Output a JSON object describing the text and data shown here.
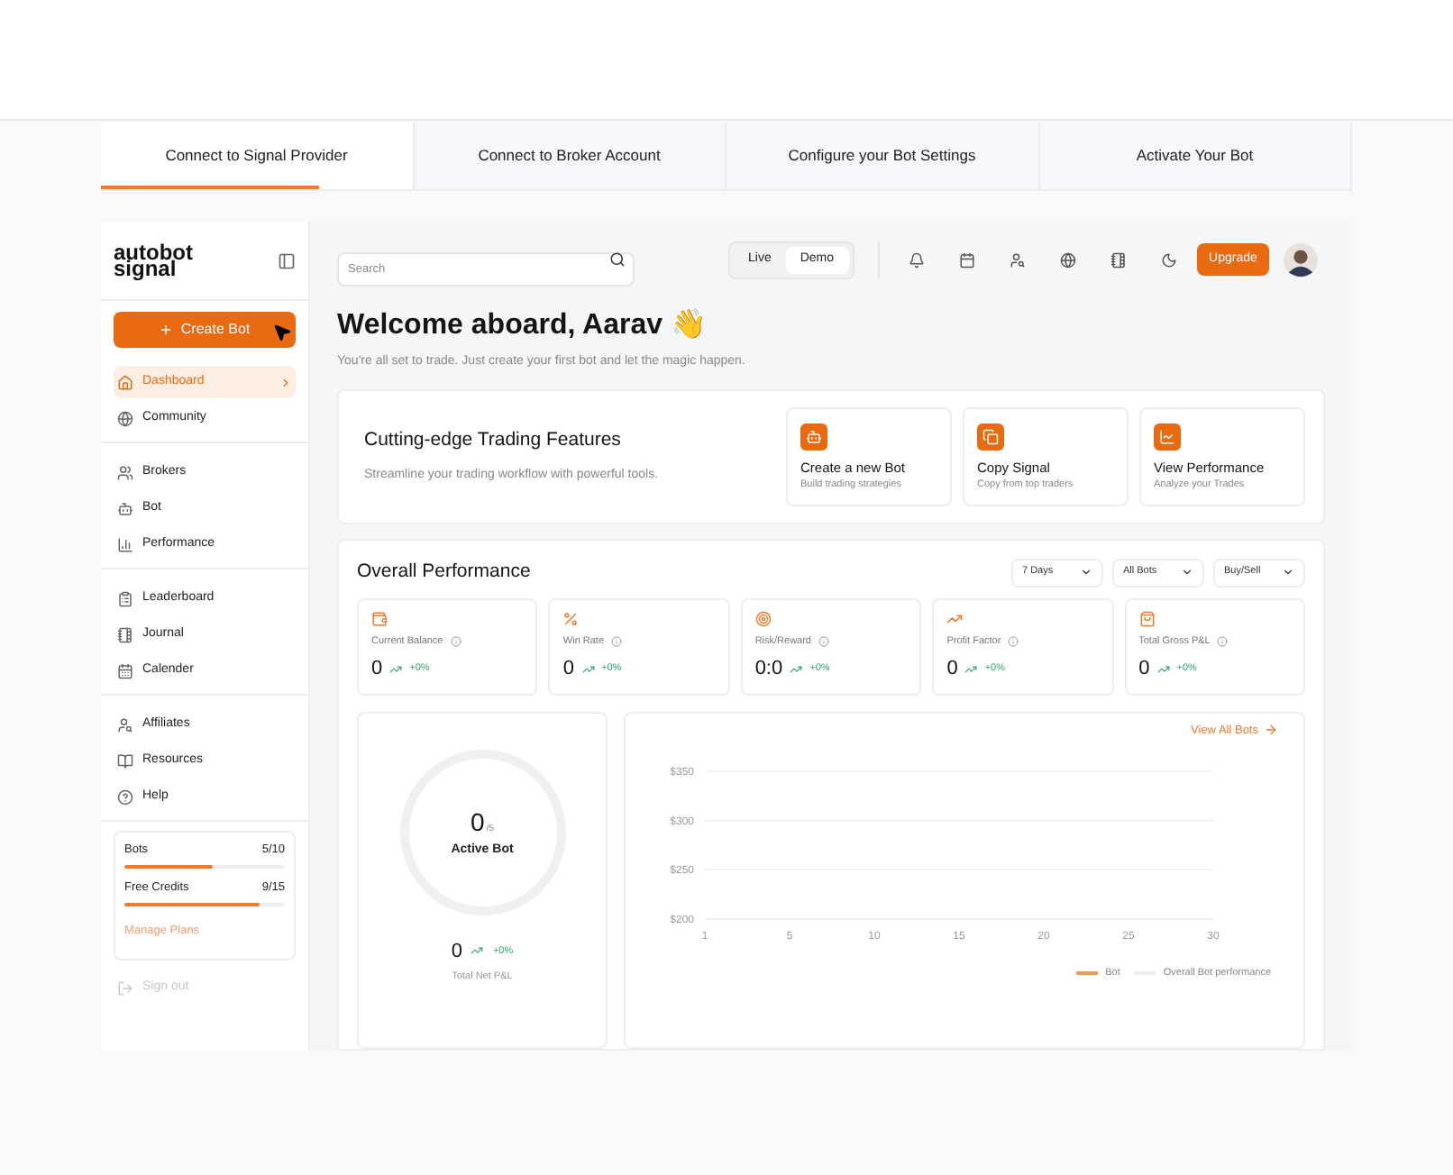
{
  "steps": [
    {
      "label": "Connect to Signal Provider",
      "selected": true
    },
    {
      "label": "Connect to Broker Account",
      "selected": false
    },
    {
      "label": "Configure your Bot Settings",
      "selected": false
    },
    {
      "label": "Activate Your Bot",
      "selected": false
    }
  ],
  "sidebar": {
    "logo": [
      "autobot",
      "signal"
    ],
    "create_button": "Create Bot",
    "groups": [
      [
        {
          "label": "Dashboard",
          "selected": true
        },
        {
          "label": "Community",
          "selected": false
        }
      ],
      [
        {
          "label": "Brokers",
          "selected": false
        },
        {
          "label": "Bot",
          "selected": false
        },
        {
          "label": "Performance",
          "selected": false
        }
      ],
      [
        {
          "label": "Leaderboard",
          "selected": false
        },
        {
          "label": "Journal",
          "selected": false
        },
        {
          "label": "Calender",
          "selected": false
        }
      ],
      [
        {
          "label": "Affiliates",
          "selected": false
        },
        {
          "label": "Resources",
          "selected": false
        },
        {
          "label": "Help",
          "selected": false
        }
      ]
    ],
    "usage": [
      {
        "label": "Bots",
        "value": "5/10",
        "level": 0.55
      },
      {
        "label": "Free Credits",
        "value": "9/15",
        "level": 0.84
      }
    ],
    "manage_link": "Manage Plans",
    "sign_out": {
      "label": "Sign out",
      "disabled": true
    }
  },
  "header": {
    "search": {
      "placeholder": "Search"
    },
    "mode": [
      {
        "label": "Live",
        "selected": false
      },
      {
        "label": "Demo",
        "selected": true
      }
    ],
    "upgrade": "Upgrade"
  },
  "welcome": {
    "title": "Welcome aboard, Aarav 👋",
    "subtitle": "You're all set to trade. Just create your first bot and let the magic happen."
  },
  "features": {
    "title": "Cutting-edge Trading Features",
    "subtitle": "Streamline your trading workflow with powerful tools.",
    "cards": [
      {
        "title": "Create a new Bot",
        "subtitle": "Build trading strategies"
      },
      {
        "title": "Copy Signal",
        "subtitle": "Copy from top traders"
      },
      {
        "title": "View Performance",
        "subtitle": "Analyze your Trades"
      }
    ]
  },
  "performance": {
    "title": "Overall Performance",
    "filters": [
      "7 Days",
      "All Bots",
      "Buy/Sell"
    ],
    "stats": [
      {
        "label": "Current Balance",
        "value": "0",
        "change": "+0%"
      },
      {
        "label": "Win Rate",
        "value": "0",
        "change": "+0%"
      },
      {
        "label": "Risk/Reward",
        "value": "0:0",
        "change": "+0%"
      },
      {
        "label": "Profit Factor",
        "value": "0",
        "change": "+0%"
      },
      {
        "label": "Total Gross P&L",
        "value": "0",
        "change": "+0%"
      }
    ],
    "active": {
      "count": "0",
      "total": "/5",
      "label": "Active Bot",
      "pnl": "0",
      "pnl_change": "+0%",
      "pnl_label": "Total Net P&L"
    },
    "view_all": "View All Bots",
    "chart_data": {
      "type": "line",
      "categories": [
        "1",
        "5",
        "10",
        "15",
        "20",
        "25",
        "30"
      ],
      "ylim": [
        200,
        350
      ],
      "yticks": [
        {
          "value": 200,
          "label": "$200"
        },
        {
          "value": 250,
          "label": "$250"
        },
        {
          "value": 300,
          "label": "$300"
        },
        {
          "value": 350,
          "label": "$350"
        }
      ],
      "series": [
        {
          "name": "Bot",
          "color": "#f59a5a",
          "values": [
            null,
            null,
            null,
            null,
            null,
            null,
            null
          ]
        },
        {
          "name": "Overall Bot performance",
          "color": "#eeeeee",
          "values": [
            null,
            null,
            null,
            null,
            null,
            null,
            null
          ]
        }
      ]
    }
  }
}
